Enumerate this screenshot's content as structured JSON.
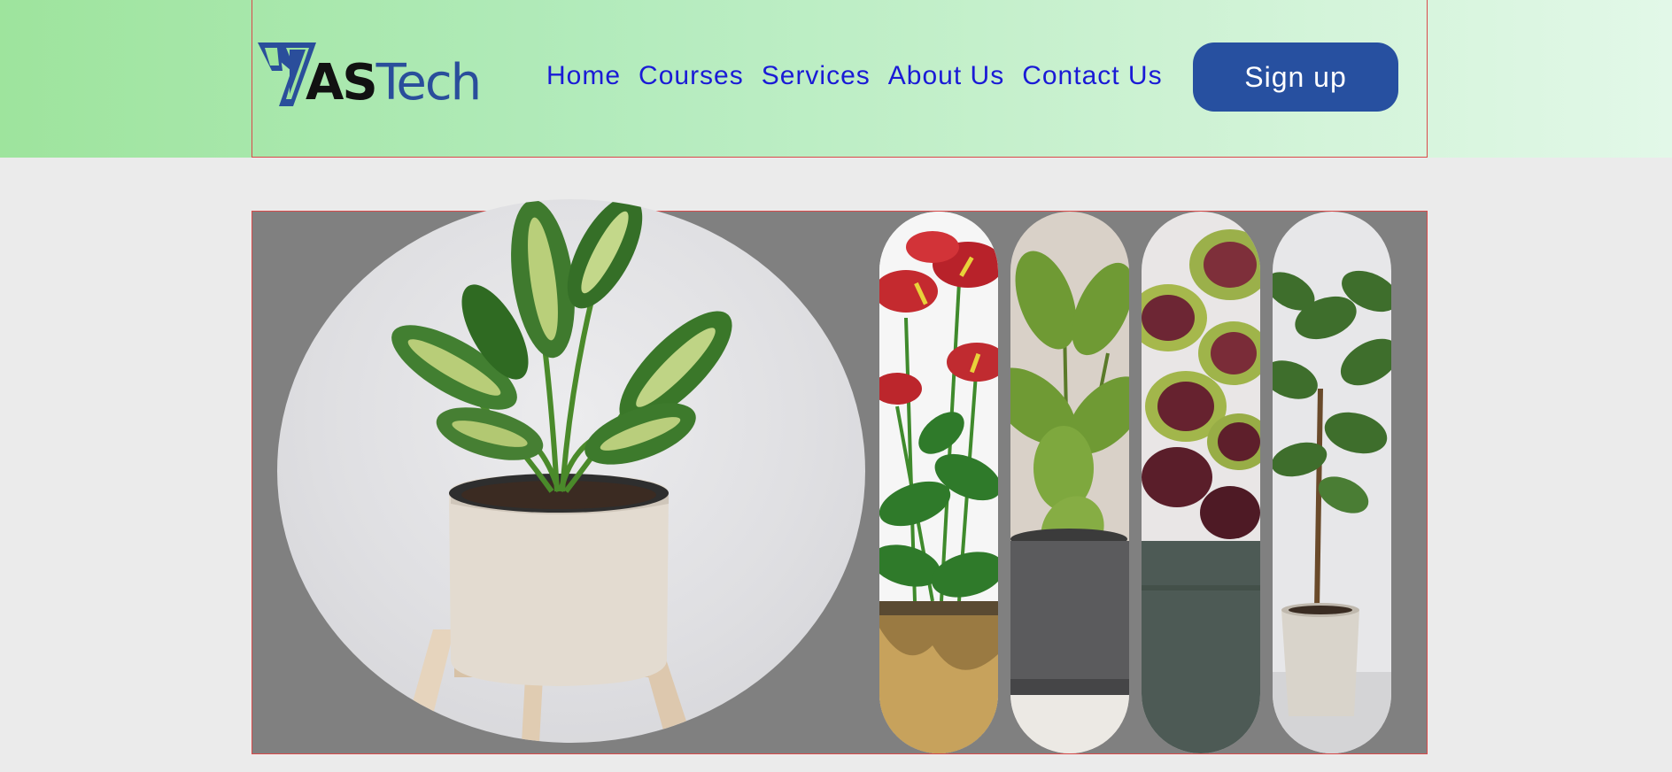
{
  "brand": {
    "logo_text_as": "AS",
    "logo_text_tech": "Tech",
    "colors": {
      "logo_mark": "#2a4e9b",
      "header_from": "#9ee49d",
      "header_to": "#e2f8e8"
    }
  },
  "nav": {
    "items": [
      {
        "label": "Home"
      },
      {
        "label": "Courses"
      },
      {
        "label": "Services"
      },
      {
        "label": "About Us"
      },
      {
        "label": "Contact Us"
      }
    ],
    "link_color": "#1a1ad6"
  },
  "signup": {
    "label": "Sign up",
    "color": "#2750a0"
  },
  "hero": {
    "main_image": "potted-dieffenbachia-plant",
    "gallery": [
      {
        "image": "anthurium-red-flowers"
      },
      {
        "image": "fiddle-leaf-fig-gray-pot"
      },
      {
        "image": "coleus-purple-green-leaves"
      },
      {
        "image": "rubber-tree-plant-white-pot"
      }
    ]
  }
}
